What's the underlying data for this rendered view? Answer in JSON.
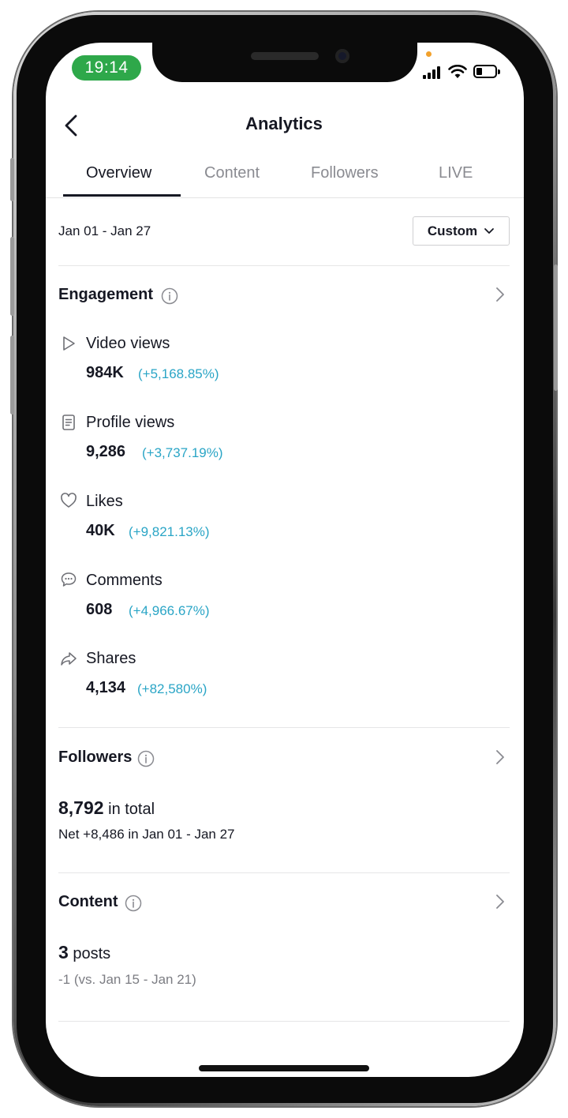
{
  "status_bar": {
    "time": "19:14"
  },
  "header": {
    "title": "Analytics"
  },
  "tabs": [
    {
      "label": "Overview",
      "active": true
    },
    {
      "label": "Content",
      "active": false
    },
    {
      "label": "Followers",
      "active": false
    },
    {
      "label": "LIVE",
      "active": false
    }
  ],
  "date_filter": {
    "range": "Jan 01 - Jan 27",
    "button_label": "Custom"
  },
  "engagement": {
    "title": "Engagement",
    "metrics": [
      {
        "icon": "play-icon",
        "label": "Video views",
        "value": "984K",
        "change": "(+5,168.85%)"
      },
      {
        "icon": "profile-doc-icon",
        "label": "Profile views",
        "value": "9,286",
        "change": "(+3,737.19%)"
      },
      {
        "icon": "heart-icon",
        "label": "Likes",
        "value": "40K",
        "change": "(+9,821.13%)"
      },
      {
        "icon": "comment-icon",
        "label": "Comments",
        "value": "608",
        "change": "(+4,966.67%)"
      },
      {
        "icon": "share-icon",
        "label": "Shares",
        "value": "4,134",
        "change": "(+82,580%)"
      }
    ]
  },
  "followers": {
    "title": "Followers",
    "total": "8,792",
    "total_suffix": "in total",
    "net": "Net +8,486 in Jan 01 - Jan 27"
  },
  "content": {
    "title": "Content",
    "posts_count": "3",
    "posts_suffix": "posts",
    "comparison": "-1 (vs. Jan 15 - Jan 21)"
  },
  "colors": {
    "accent_change": "#2aa5c6",
    "time_pill": "#2ea84a",
    "text": "#161823"
  }
}
